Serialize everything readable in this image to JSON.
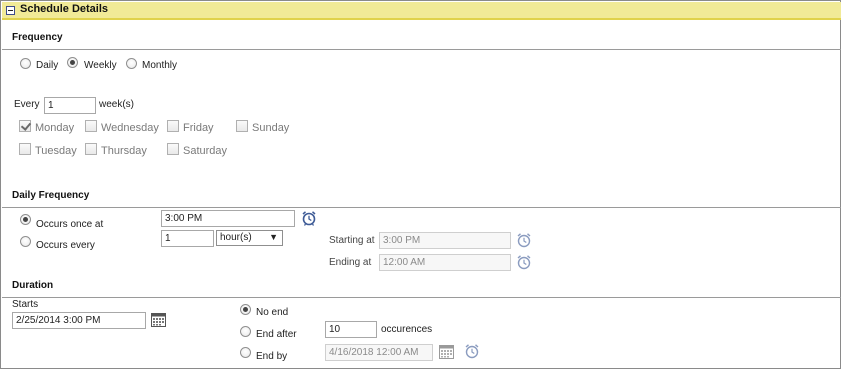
{
  "header": {
    "title": "Schedule Details"
  },
  "frequency": {
    "title": "Frequency",
    "options": [
      "Daily",
      "Weekly",
      "Monthly"
    ],
    "selected": "Weekly",
    "every_label": "Every",
    "every_value": "1",
    "unit_label": "week(s)",
    "days": [
      {
        "label": "Monday",
        "checked": true
      },
      {
        "label": "Wednesday",
        "checked": false
      },
      {
        "label": "Friday",
        "checked": false
      },
      {
        "label": "Sunday",
        "checked": false
      },
      {
        "label": "Tuesday",
        "checked": false
      },
      {
        "label": "Thursday",
        "checked": false
      },
      {
        "label": "Saturday",
        "checked": false
      }
    ]
  },
  "daily_frequency": {
    "title": "Daily Frequency",
    "once_label": "Occurs once at",
    "once_time": "3:00 PM",
    "every_label": "Occurs every",
    "every_value": "1",
    "every_unit": "hour(s)",
    "starting_label": "Starting at",
    "starting_value": "3:00 PM",
    "ending_label": "Ending at",
    "ending_value": "12:00 AM"
  },
  "duration": {
    "title": "Duration",
    "starts_label": "Starts",
    "starts_value": "2/25/2014 3:00 PM",
    "no_end_label": "No end",
    "end_after_label": "End after",
    "end_after_value": "10",
    "occurrences_label": "occurences",
    "end_by_label": "End by",
    "end_by_value": "4/16/2018 12:00 AM"
  },
  "icons": {
    "clock": "alarm-clock-icon",
    "calendar": "calendar-icon",
    "collapse": "collapse-minus-icon"
  },
  "colors": {
    "header_bg": "#f1ea97",
    "header_border": "#e0d24c",
    "icon_blue": "#3d5a96"
  }
}
